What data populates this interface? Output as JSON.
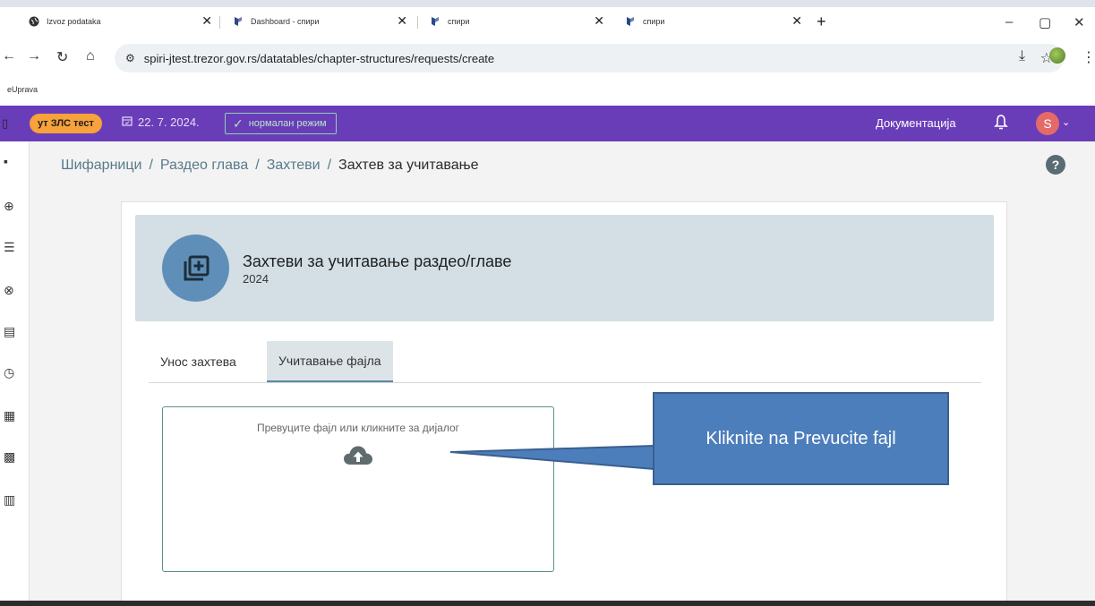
{
  "browser": {
    "tabs": [
      {
        "title": "Izvoz podataka",
        "active": false
      },
      {
        "title": "Dashboard - спири",
        "active": false
      },
      {
        "title": "спири",
        "active": false
      },
      {
        "title": "спири",
        "active": true
      }
    ],
    "url": "spiri-jtest.trezor.gov.rs/datatables/chapter-structures/requests/create",
    "bookmark": "eUprava"
  },
  "appbar": {
    "env_badge": "ут ЗЛС тест",
    "date": "22. 7. 2024.",
    "mode": "нормалан режим",
    "docs_link": "Документација",
    "user_initial": "S",
    "color": "#6a3db8"
  },
  "breadcrumb": {
    "items": [
      "Шифарници",
      "Раздео глава",
      "Захтеви"
    ],
    "current": "Захтев за учитавање"
  },
  "banner": {
    "title": "Захтеви за учитавање раздео/главе",
    "year": "2024"
  },
  "form_tabs": [
    {
      "label": "Унос захтева",
      "selected": false
    },
    {
      "label": "Учитавање фајла",
      "selected": true
    }
  ],
  "dropzone": {
    "text": "Превуците фајл или кликните за дијалог",
    "icon": "cloud-upload-icon"
  },
  "callout": {
    "text": "Kliknite na Prevucite fajl",
    "color": "#4d7ebc"
  }
}
